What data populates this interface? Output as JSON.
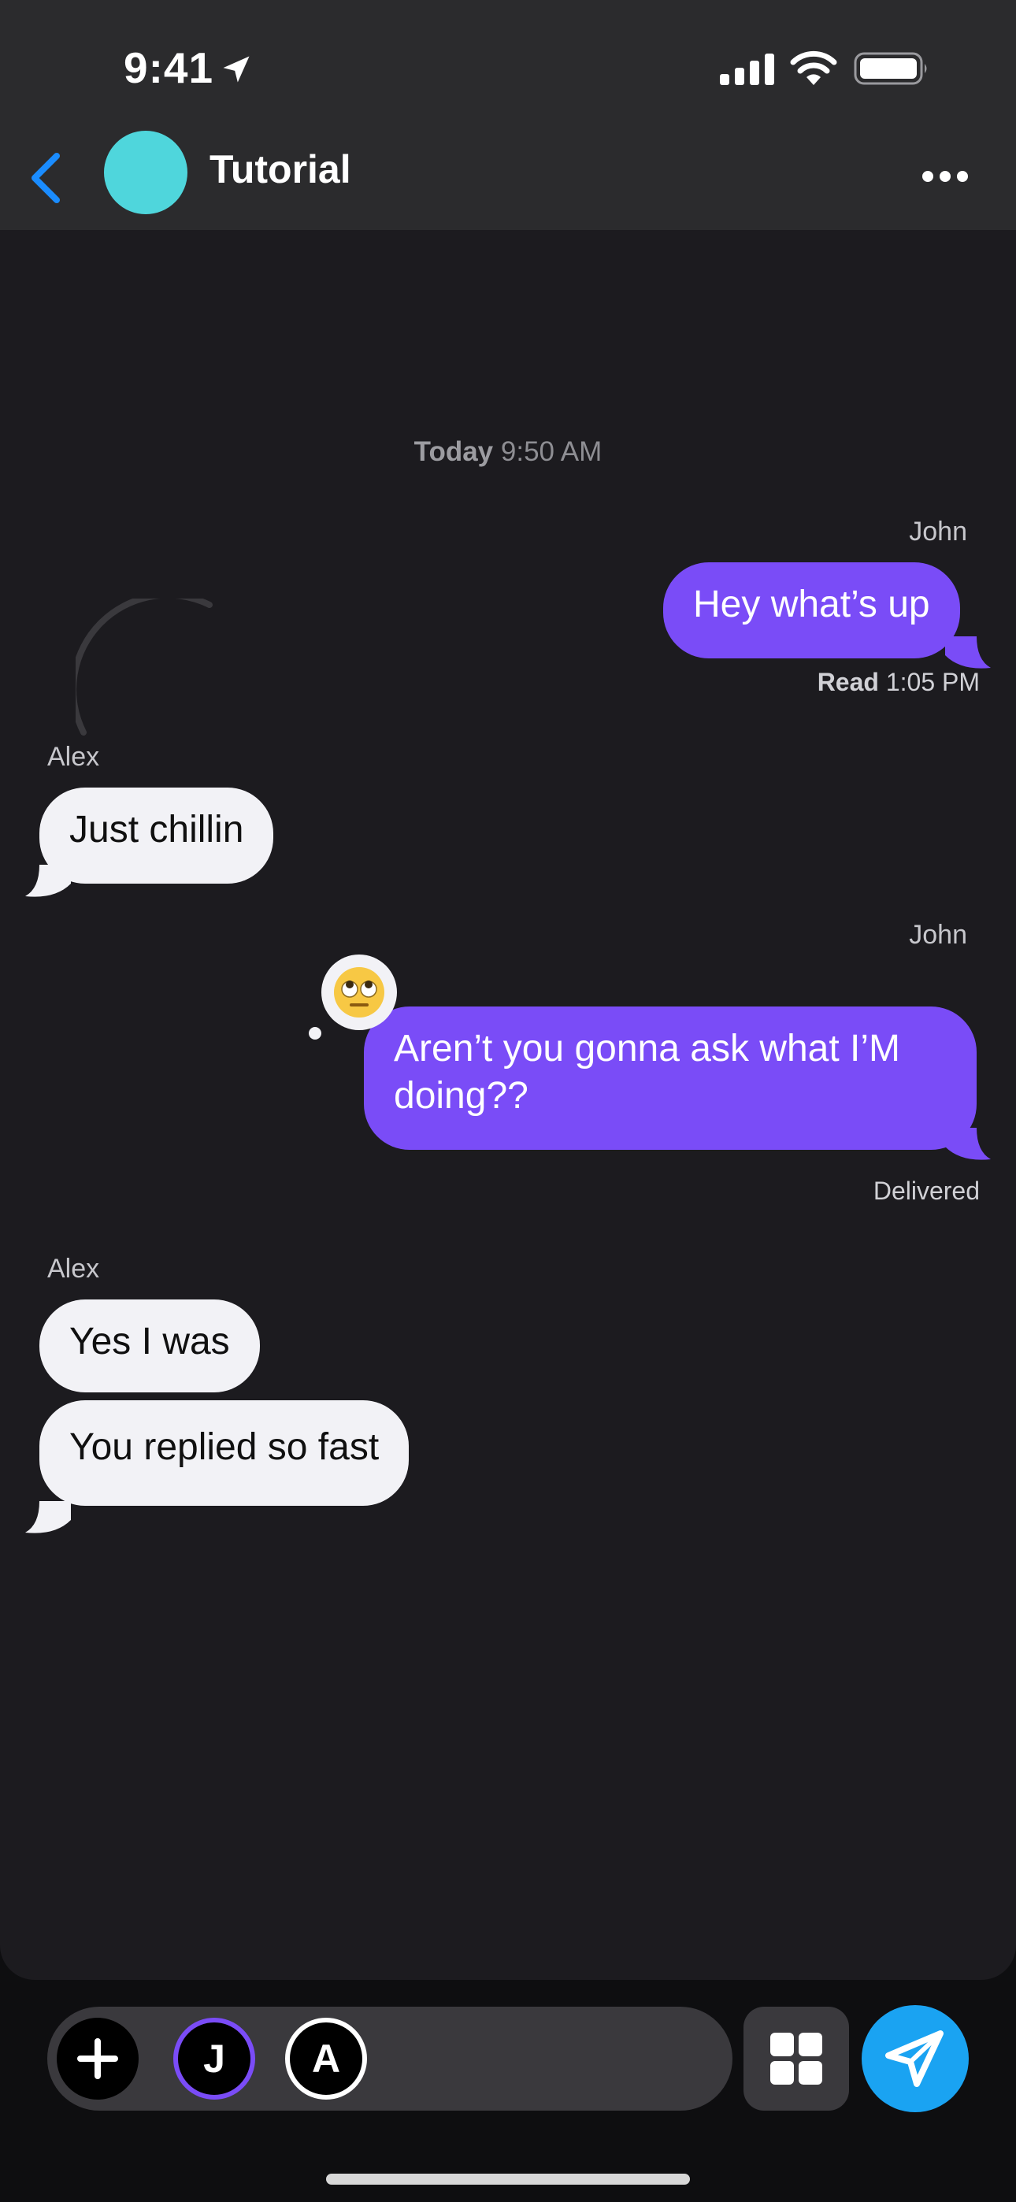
{
  "status_bar": {
    "time": "9:41"
  },
  "header": {
    "title": "Tutorial",
    "avatar_color": "#4fd6dc"
  },
  "chat": {
    "timestamp_day": "Today",
    "timestamp_time": "9:50 AM",
    "messages": [
      {
        "sender": "John",
        "text": "Hey what’s up",
        "direction": "outgoing",
        "receipt_label": "Read",
        "receipt_time": "1:05 PM"
      },
      {
        "sender": "Alex",
        "text": "Just chillin",
        "direction": "incoming"
      },
      {
        "sender": "John",
        "text": "Aren’t you gonna ask what I’M doing??",
        "direction": "outgoing",
        "reaction_icon": "face-with-rolling-eyes",
        "receipt_label": "Delivered"
      },
      {
        "sender": "Alex",
        "text": "Yes I was",
        "direction": "incoming"
      },
      {
        "text": "You replied so fast",
        "direction": "incoming"
      }
    ]
  },
  "composer": {
    "avatar_1_initial": "J",
    "avatar_2_initial": "A",
    "icons": [
      "plus-icon",
      "apps-grid-icon",
      "send-icon"
    ]
  },
  "colors": {
    "outgoing_bubble": "#7a4cf7",
    "incoming_bubble": "#f2f2f6",
    "send_button": "#1aa3f2",
    "back_chevron": "#1a8cff"
  }
}
